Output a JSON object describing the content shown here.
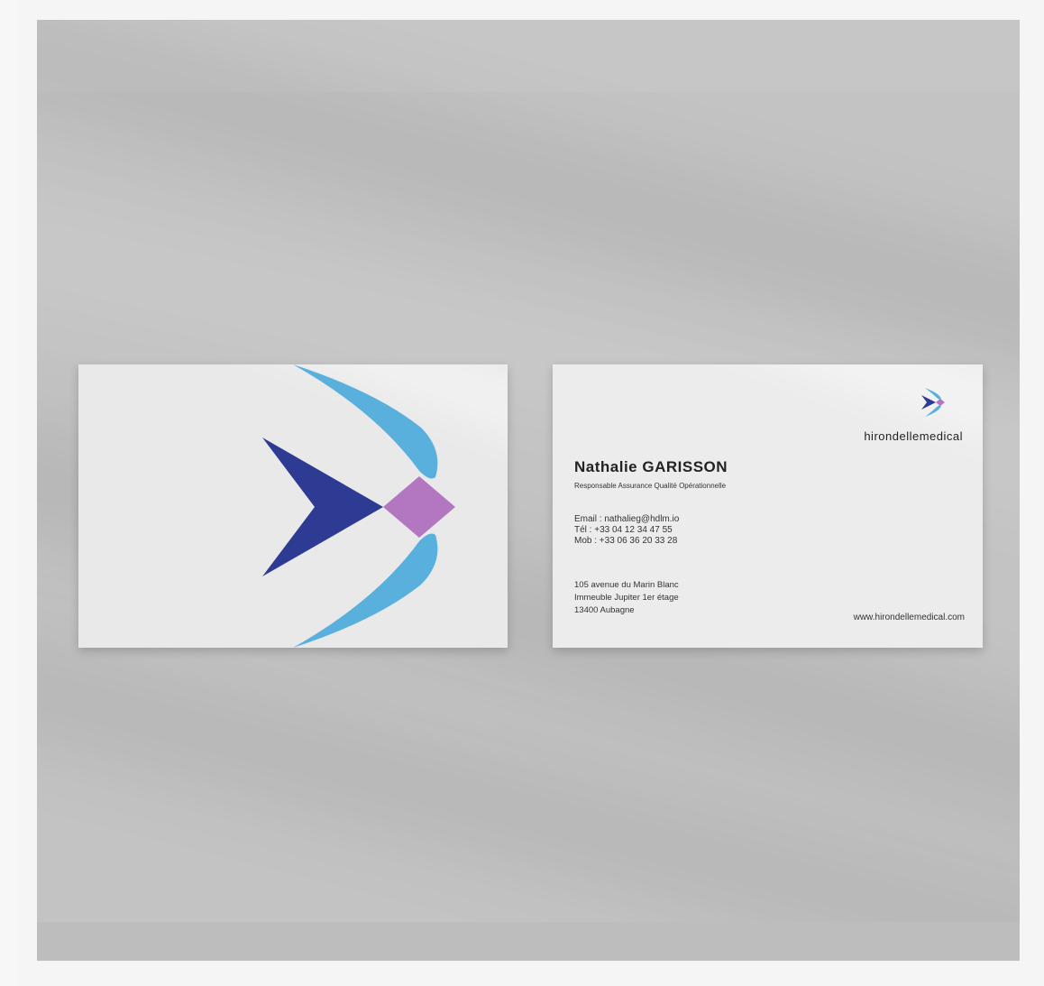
{
  "mockup": {
    "colors": {
      "background": "#c3c3c3",
      "card": "#e9e9ea",
      "navy": "#2e3b93",
      "sky": "#59b0dd",
      "violet": "#b377c2"
    }
  },
  "card_front": {
    "logo": "hirondelle-arrow-icon"
  },
  "card_back": {
    "logo": "hirondelle-bird-icon",
    "brand_prefix": "hirondelle",
    "brand_suffix": "medical",
    "name": "Nathalie GARISSON",
    "role": "Responsable Assurance Qualité Opérationnelle",
    "email": "Email : nathalieg@hdlm.io",
    "tel": "Tél : +33 04 12 34 47 55",
    "mobile": "Mob : +33 06 36 20 33 28",
    "address_line1": "105 avenue du Marin Blanc",
    "address_line2": "Immeuble Jupiter 1er étage",
    "address_line3": "13400 Aubagne",
    "website": "www.hirondellemedical.com"
  }
}
